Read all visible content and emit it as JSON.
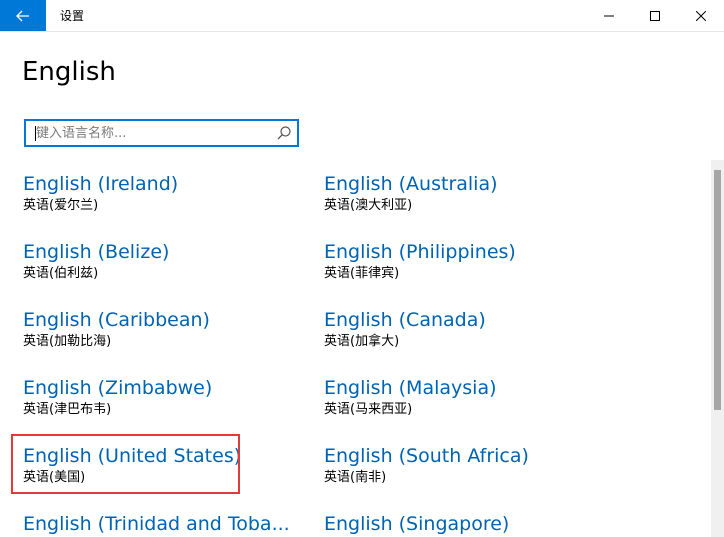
{
  "window": {
    "title": "设置",
    "back_icon": "arrow-left-icon",
    "minimize_icon": "minimize-icon",
    "maximize_icon": "maximize-icon",
    "close_icon": "close-icon",
    "accent_color": "#0078d7"
  },
  "page": {
    "heading": "English"
  },
  "search": {
    "placeholder": "键入语言名称...",
    "value": "",
    "icon": "search-icon"
  },
  "languages": {
    "col1": [
      {
        "name": "English (Ireland)",
        "native": "英语(爱尔兰)"
      },
      {
        "name": "English (Belize)",
        "native": "英语(伯利兹)"
      },
      {
        "name": "English (Caribbean)",
        "native": "英语(加勒比海)"
      },
      {
        "name": "English (Zimbabwe)",
        "native": "英语(津巴布韦)"
      },
      {
        "name": "English (United States)",
        "native": "英语(美国)"
      },
      {
        "name": "English (Trinidad and Toba...",
        "native": ""
      }
    ],
    "col2": [
      {
        "name": "English (Australia)",
        "native": "英语(澳大利亚)"
      },
      {
        "name": "English (Philippines)",
        "native": "英语(菲律宾)"
      },
      {
        "name": "English (Canada)",
        "native": "英语(加拿大)"
      },
      {
        "name": "English (Malaysia)",
        "native": "英语(马来西亚)"
      },
      {
        "name": "English (South Africa)",
        "native": "英语(南非)"
      },
      {
        "name": "English (Singapore)",
        "native": ""
      }
    ],
    "link_color": "#0063b1",
    "highlight_color": "#e03a3a"
  }
}
